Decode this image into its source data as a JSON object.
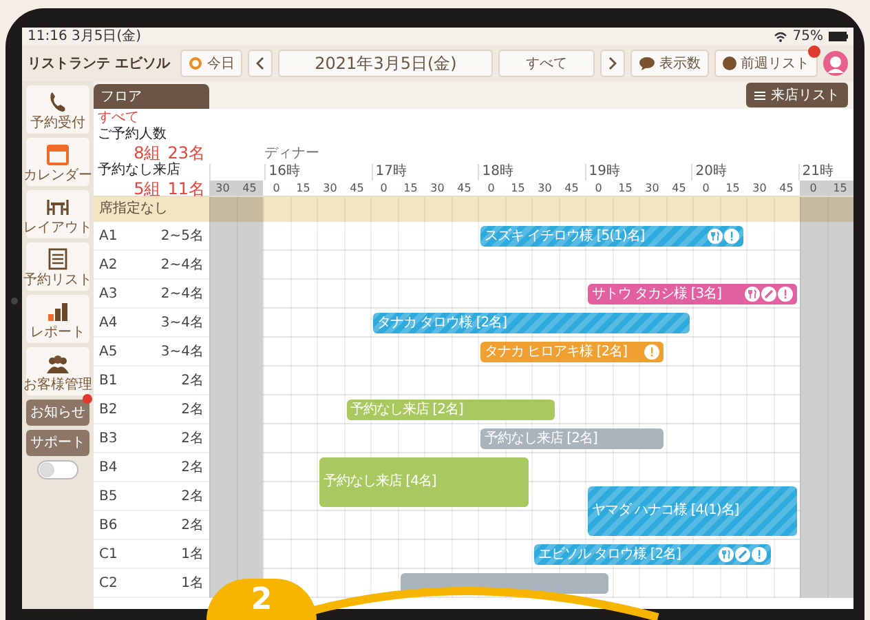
{
  "status_bar": {
    "time": "11:16 3月5日(金)",
    "battery": "75%"
  },
  "toolbar": {
    "restaurant": "リストランテ エビソル",
    "today": "今日",
    "date": "2021年3月5日(金)",
    "filter": "すべて",
    "display_count": "表示数",
    "list": "前週リスト"
  },
  "sidebar": [
    {
      "label": "予約受付"
    },
    {
      "label": "カレンダー"
    },
    {
      "label": "レイアウト"
    },
    {
      "label": "予約リスト"
    },
    {
      "label": "レポート"
    },
    {
      "label": "お客様管理"
    }
  ],
  "sidebar_buttons": [
    {
      "label": "お知らせ",
      "badge": true
    },
    {
      "label": "サポート",
      "badge": false
    }
  ],
  "toggle": {
    "on": false
  },
  "floor_tab": "フロア",
  "visit_list_button": "来店リスト",
  "summary": {
    "filter": "すべて",
    "stats": [
      {
        "label": "ご予約人数",
        "groups": "8組",
        "people": "23名"
      },
      {
        "label": "予約なし来店",
        "groups": "5組",
        "people": "11名"
      }
    ]
  },
  "timeline": {
    "section": "ディナー",
    "groups": [
      {
        "minutes": [
          "30",
          "45"
        ],
        "closed": true
      },
      {
        "hour": "16時",
        "minutes": [
          "0",
          "15",
          "30",
          "45"
        ],
        "closed": false
      },
      {
        "hour": "17時",
        "minutes": [
          "0",
          "15",
          "30",
          "45"
        ],
        "closed": false
      },
      {
        "hour": "18時",
        "minutes": [
          "0",
          "15",
          "30",
          "45"
        ],
        "closed": false
      },
      {
        "hour": "19時",
        "minutes": [
          "0",
          "15",
          "30",
          "45"
        ],
        "closed": false
      },
      {
        "hour": "20時",
        "minutes": [
          "0",
          "15",
          "30",
          "45"
        ],
        "closed": false
      },
      {
        "hour": "21時",
        "minutes": [
          "0",
          "15"
        ],
        "closed": true
      }
    ]
  },
  "unassigned_row": "席指定なし",
  "tables": [
    {
      "name": "A1",
      "capacity": "2~5名",
      "bookings": [
        {
          "label": "スズキ イチロウ様 [5(1)名]",
          "color": "#2eaadc",
          "striped": true,
          "double": false,
          "cutlery": true,
          "pencil": false,
          "alert": true
        }
      ]
    },
    {
      "name": "A2",
      "capacity": "2~4名"
    },
    {
      "name": "A3",
      "capacity": "2~4名",
      "bookings": [
        {
          "label": "サトウ タカシ様 [3名]",
          "color": "#e2609f",
          "striped": false,
          "double": false,
          "cutlery": true,
          "pencil": true,
          "alert": true
        }
      ]
    },
    {
      "name": "A4",
      "capacity": "3~4名",
      "bookings": [
        {
          "label": "タナカ タロウ様 [2名]",
          "color": "#2eaadc",
          "striped": true,
          "double": false,
          "cutlery": false,
          "pencil": false,
          "alert": false
        }
      ]
    },
    {
      "name": "A5",
      "capacity": "3~4名",
      "bookings": [
        {
          "label": "タナカ ヒロアキ様 [2名]",
          "color": "#f0a030",
          "striped": false,
          "double": false,
          "cutlery": false,
          "pencil": false,
          "alert": true
        }
      ]
    },
    {
      "name": "B1",
      "capacity": "2名"
    },
    {
      "name": "B2",
      "capacity": "2名",
      "bookings": [
        {
          "label": "予約なし来店 [2名]",
          "color": "#a8c860",
          "striped": false,
          "double": false,
          "cutlery": false,
          "pencil": false,
          "alert": false
        }
      ]
    },
    {
      "name": "B3",
      "capacity": "2名",
      "bookings": [
        {
          "label": "予約なし来店 [2名]",
          "color": "#a9b4bc",
          "striped": false,
          "double": false,
          "cutlery": false,
          "pencil": false,
          "alert": false
        }
      ]
    },
    {
      "name": "B4",
      "capacity": "2名",
      "bookings": [
        {
          "label": "予約なし来店 [4名]",
          "color": "#a8c860",
          "striped": false,
          "double": true,
          "cutlery": false,
          "pencil": false,
          "alert": false
        }
      ]
    },
    {
      "name": "B5",
      "capacity": "2名",
      "bookings": [
        {
          "label": "ヤマダ ハナコ様 [4(1)名]",
          "color": "#2eaadc",
          "striped": true,
          "double": true,
          "cutlery": false,
          "pencil": false,
          "alert": false
        }
      ]
    },
    {
      "name": "B6",
      "capacity": "2名"
    },
    {
      "name": "C1",
      "capacity": "1名",
      "bookings": [
        {
          "label": "エビソル タロウ様 [2名]",
          "color": "#2eaadc",
          "striped": true,
          "double": false,
          "cutlery": true,
          "pencil": true,
          "alert": true
        }
      ]
    },
    {
      "name": "C2",
      "capacity": "1名",
      "bookings": [
        {
          "color": "#a9b4bc",
          "striped": false,
          "double": false,
          "cutlery": false,
          "pencil": false,
          "alert": false
        }
      ]
    }
  ],
  "step_badge": "2"
}
